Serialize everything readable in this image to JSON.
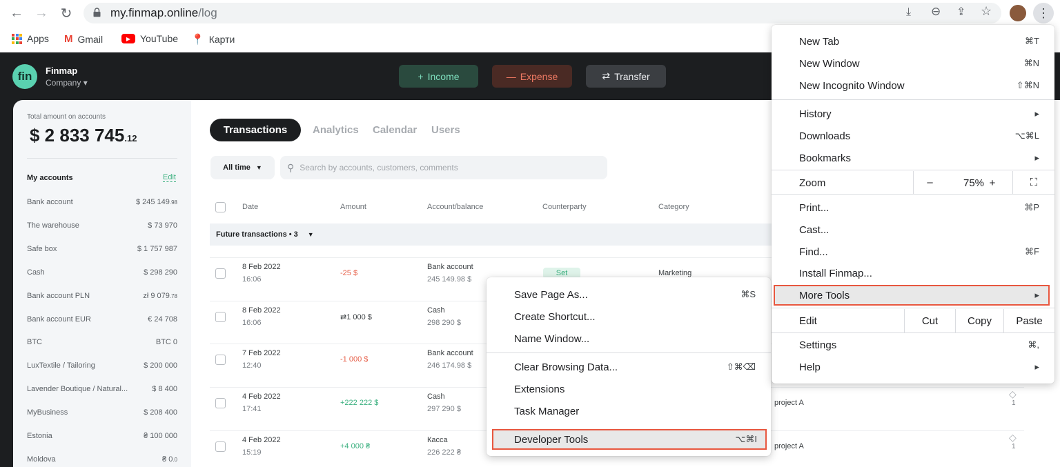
{
  "browser": {
    "url_host": "my.finmap.online",
    "url_path": "/log",
    "bookmarks": [
      {
        "label": "Apps",
        "icon": "apps-grid-icon"
      },
      {
        "label": "Gmail",
        "icon": "gmail-icon"
      },
      {
        "label": "YouTube",
        "icon": "youtube-icon"
      },
      {
        "label": "Карти",
        "icon": "maps-pin-icon"
      }
    ]
  },
  "app": {
    "logo": "fin",
    "name": "Finmap",
    "company": "Company",
    "header_buttons": {
      "income": "Income",
      "expense": "Expense",
      "transfer": "Transfer"
    },
    "colors": {
      "income": "#5ad1b0",
      "expense": "#ef7a63",
      "accent": "#3bb07f"
    }
  },
  "sidebar": {
    "total_label": "Total amount on accounts",
    "total_main": "$ 2 833 745",
    "total_cents": ".12",
    "accounts_title": "My accounts",
    "edit": "Edit",
    "accounts": [
      {
        "name": "Bank account",
        "value": "$ 245 149",
        "cents": ".98"
      },
      {
        "name": "The warehouse",
        "value": "$ 73 970",
        "cents": ""
      },
      {
        "name": "Safe box",
        "value": "$ 1 757 987",
        "cents": ""
      },
      {
        "name": "Cash",
        "value": "$ 298 290",
        "cents": ""
      },
      {
        "name": "Bank account PLN",
        "value": "zł 9 079",
        "cents": ".78"
      },
      {
        "name": "Bank account EUR",
        "value": "€ 24 708",
        "cents": ""
      },
      {
        "name": "BTC",
        "value": "BTC 0",
        "cents": ""
      },
      {
        "name": "LuxTextile / Tailoring",
        "value": "$ 200 000",
        "cents": ""
      },
      {
        "name": "Lavender Boutique / Natural...",
        "value": "$ 8 400",
        "cents": ""
      },
      {
        "name": "MyBusiness",
        "value": "$ 208 400",
        "cents": ""
      },
      {
        "name": "Estonia",
        "value": "₴ 100 000",
        "cents": ""
      },
      {
        "name": "Moldova",
        "value": "₴ 0",
        "cents": ".0"
      }
    ]
  },
  "main": {
    "tabs": [
      "Transactions",
      "Analytics",
      "Calendar",
      "Users"
    ],
    "filter": "All time",
    "search_placeholder": "Search by accounts, customers, comments",
    "columns": [
      "Date",
      "Amount",
      "Account/balance",
      "Counterparty",
      "Category"
    ],
    "future_label": "Future transactions • 3",
    "rows": [
      {
        "date": "8 Feb 2022",
        "time": "16:06",
        "amount": "-25 $",
        "type": "neg",
        "account": "Bank account",
        "balance": "245 149.98 $",
        "counterparty": "Set",
        "category": "Marketing",
        "tag": ""
      },
      {
        "date": "8 Feb 2022",
        "time": "16:06",
        "amount": "⇄1 000 $",
        "type": "transfer",
        "account": "Cash",
        "balance": "298 290 $",
        "counterparty": "",
        "category": "",
        "tag": ""
      },
      {
        "date": "7 Feb 2022",
        "time": "12:40",
        "amount": "-1 000 $",
        "type": "neg",
        "account": "Bank account",
        "balance": "246 174.98 $",
        "counterparty": "",
        "category": "",
        "tag": ""
      },
      {
        "date": "4 Feb 2022",
        "time": "17:41",
        "amount": "+222 222 $",
        "type": "pos",
        "account": "Cash",
        "balance": "297 290 $",
        "counterparty": "",
        "category": "project A",
        "tag": "1"
      },
      {
        "date": "4 Feb 2022",
        "time": "15:19",
        "amount": "+4 000 ₴",
        "type": "pos",
        "account": "Касса",
        "balance": "226 222 ₴",
        "counterparty": "",
        "category": "project A",
        "tag": "1"
      }
    ]
  },
  "chrome_menu": {
    "items": [
      {
        "label": "New Tab",
        "shortcut": "⌘T"
      },
      {
        "label": "New Window",
        "shortcut": "⌘N"
      },
      {
        "label": "New Incognito Window",
        "shortcut": "⇧⌘N"
      },
      {
        "label": "History",
        "shortcut": "▸"
      },
      {
        "label": "Downloads",
        "shortcut": "⌥⌘L"
      },
      {
        "label": "Bookmarks",
        "shortcut": "▸"
      },
      {
        "label": "Print...",
        "shortcut": "⌘P"
      },
      {
        "label": "Cast...",
        "shortcut": ""
      },
      {
        "label": "Find...",
        "shortcut": "⌘F"
      },
      {
        "label": "Install Finmap...",
        "shortcut": ""
      },
      {
        "label": "More Tools",
        "shortcut": "▸"
      },
      {
        "label": "Settings",
        "shortcut": "⌘,"
      },
      {
        "label": "Help",
        "shortcut": "▸"
      }
    ],
    "zoom_label": "Zoom",
    "zoom_minus": "–",
    "zoom_value": "75%",
    "zoom_plus": "+",
    "edit_label": "Edit",
    "cut": "Cut",
    "copy": "Copy",
    "paste": "Paste"
  },
  "submenu": {
    "items": [
      {
        "label": "Save Page As...",
        "shortcut": "⌘S"
      },
      {
        "label": "Create Shortcut...",
        "shortcut": ""
      },
      {
        "label": "Name Window...",
        "shortcut": ""
      },
      {
        "label": "Clear Browsing Data...",
        "shortcut": "⇧⌘⌫"
      },
      {
        "label": "Extensions",
        "shortcut": ""
      },
      {
        "label": "Task Manager",
        "shortcut": ""
      },
      {
        "label": "Developer Tools",
        "shortcut": "⌥⌘I"
      }
    ]
  }
}
